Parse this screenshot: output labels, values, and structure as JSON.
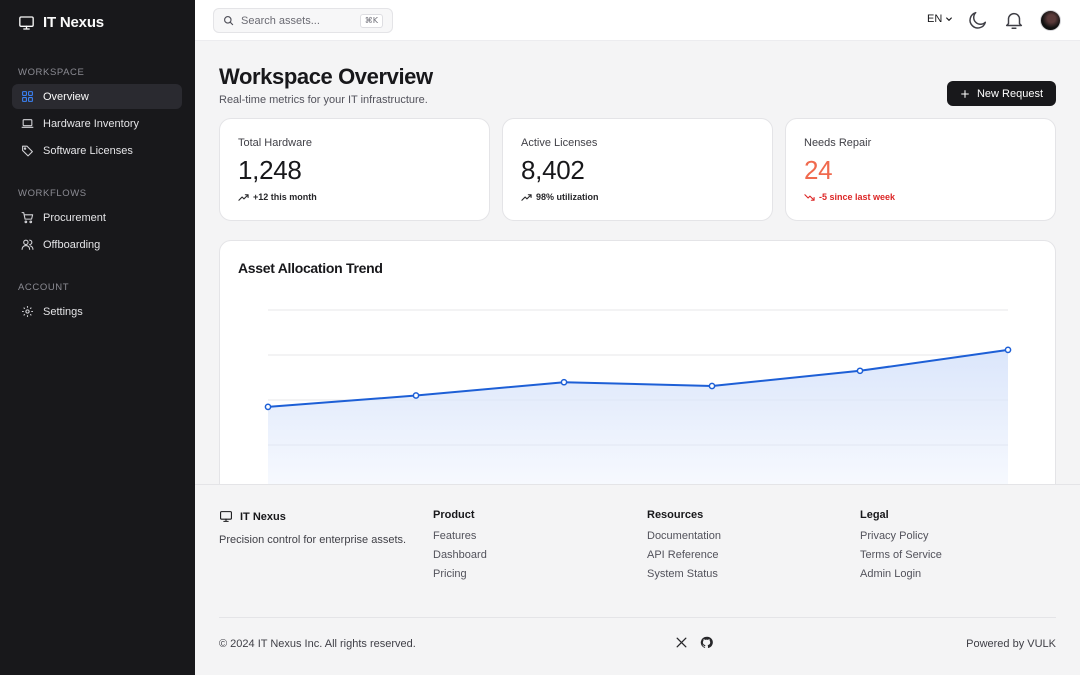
{
  "app": {
    "name": "IT Nexus"
  },
  "sidebar": {
    "sections": [
      {
        "title": "Workspace",
        "items": [
          {
            "label": "Overview",
            "icon": "grid-icon",
            "active": true
          },
          {
            "label": "Hardware Inventory",
            "icon": "laptop-icon"
          },
          {
            "label": "Software Licenses",
            "icon": "tag-icon"
          }
        ]
      },
      {
        "title": "Workflows",
        "items": [
          {
            "label": "Procurement",
            "icon": "cart-icon"
          },
          {
            "label": "Offboarding",
            "icon": "users-icon"
          }
        ]
      },
      {
        "title": "Account",
        "items": [
          {
            "label": "Settings",
            "icon": "gear-icon"
          }
        ]
      }
    ]
  },
  "topbar": {
    "search_placeholder": "Search assets...",
    "search_shortcut": "⌘K",
    "language": "EN"
  },
  "main": {
    "title": "Workspace Overview",
    "subtitle": "Real-time metrics for your IT infrastructure.",
    "new_request_label": "New Request",
    "cards": [
      {
        "label": "Total Hardware",
        "value": "1,248",
        "delta": "+12 this month",
        "trend": "up"
      },
      {
        "label": "Active Licenses",
        "value": "8,402",
        "delta": "98% utilization",
        "trend": "up"
      },
      {
        "label": "Needs Repair",
        "value": "24",
        "delta": "-5 since last week",
        "trend": "down",
        "accent": "#f06a4e"
      }
    ]
  },
  "chart_data": {
    "type": "area",
    "title": "Asset Allocation Trend",
    "values": [
      0.51,
      0.45,
      0.38,
      0.4,
      0.32,
      0.21
    ],
    "ylim": [
      0,
      1
    ],
    "grid": true,
    "line_color": "#1d5fd6",
    "fill_color": "#dbe6fb"
  },
  "footer": {
    "brand": "IT Nexus",
    "tagline": "Precision control for enterprise assets.",
    "columns": [
      {
        "title": "Product",
        "links": [
          "Features",
          "Dashboard",
          "Pricing"
        ]
      },
      {
        "title": "Resources",
        "links": [
          "Documentation",
          "API Reference",
          "System Status"
        ]
      },
      {
        "title": "Legal",
        "links": [
          "Privacy Policy",
          "Terms of Service",
          "Admin Login"
        ]
      }
    ],
    "copyright": "© 2024 IT Nexus Inc. All rights reserved.",
    "powered_by": "Powered by VULK",
    "social": [
      "x-icon",
      "github-icon"
    ]
  }
}
